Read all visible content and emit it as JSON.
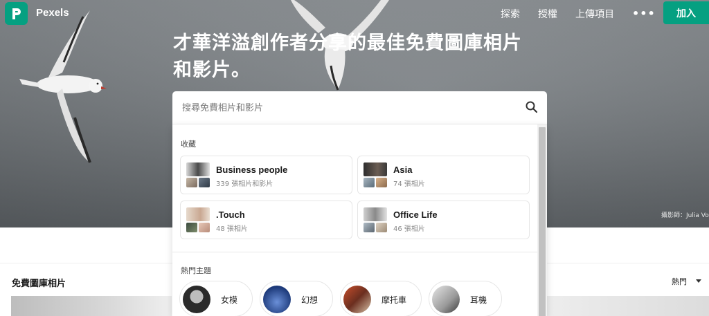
{
  "header": {
    "brand": "Pexels",
    "nav": [
      "探索",
      "授權",
      "上傳項目"
    ],
    "more": "•••",
    "join": "加入"
  },
  "hero": {
    "title_line1": "才華洋溢創作者分享的最佳免費圖庫相片",
    "title_line2": "和影片。",
    "credit": "攝影師：Julia Vo"
  },
  "search": {
    "placeholder": "搜尋免費相片和影片"
  },
  "dropdown": {
    "collections_label": "收藏",
    "collections": [
      {
        "title": "Business people",
        "count": "339 張相片和影片"
      },
      {
        "title": "Asia",
        "count": "74 張相片"
      },
      {
        "title": ".Touch",
        "count": "48 張相片"
      },
      {
        "title": "Office Life",
        "count": "46 張相片"
      }
    ],
    "topics_label": "熱門主題",
    "topics": [
      "女模",
      "幻想",
      "摩托車",
      "耳機"
    ]
  },
  "main": {
    "section_title": "免費圖庫相片",
    "sort": "熱門"
  },
  "colors": {
    "accent": "#05a081"
  }
}
